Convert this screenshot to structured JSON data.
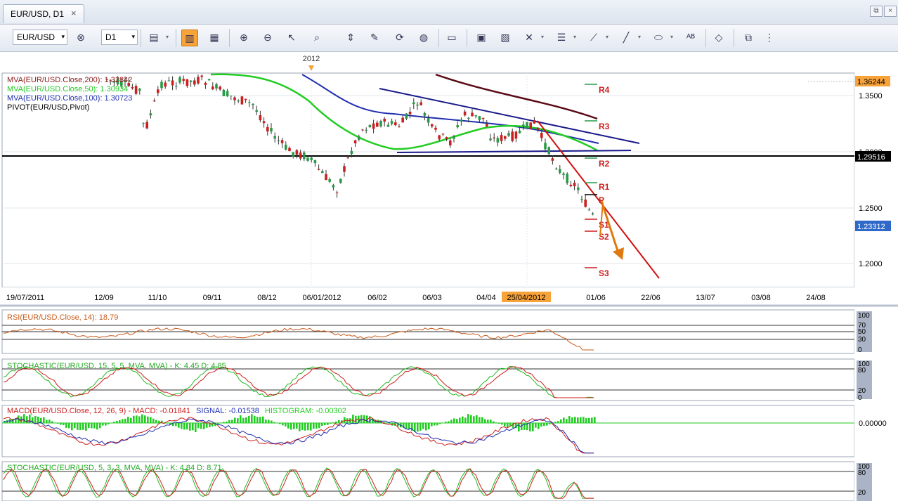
{
  "tab": {
    "label": "EUR/USD, D1",
    "close": "×"
  },
  "window_controls": {
    "restore": "⧉",
    "close": "×"
  },
  "toolbar": {
    "symbol": "EUR/USD",
    "timeframe": "D1",
    "dropdown_arrow": "▾"
  },
  "main_chart": {
    "year_label": "2012",
    "indicators": [
      {
        "text": "MVA(EUR/USD.Close,200): 1.32842",
        "color": "#8b1a1a"
      },
      {
        "text": "MVA(EUR/USD.Close,50): 1.30934",
        "color": "#22cc22"
      },
      {
        "text": "MVA(EUR/USD.Close,100): 1.30723",
        "color": "#1f2fb0"
      },
      {
        "text": "PIVOT(EUR/USD,Pivot)",
        "color": "#000000"
      }
    ],
    "price_labels": [
      "1.3500",
      "1.3000",
      "1.2500",
      "1.2000"
    ],
    "price_badges": {
      "top": "1.36244",
      "level": "1.29516",
      "last": "1.23312"
    },
    "pivots": [
      "R4",
      "R3",
      "R2",
      "R1",
      "P",
      "S1",
      "S2",
      "S3"
    ],
    "x_labels": [
      "19/07/2011",
      "12/09",
      "11/10",
      "09/11",
      "08/12",
      "06/01/2012",
      "06/02",
      "06/03",
      "04/04",
      "25/04/2012",
      "01/06",
      "22/06",
      "13/07",
      "03/08",
      "24/08"
    ]
  },
  "rsi": {
    "title": "RSI(EUR/USD.Close, 14): 18.79",
    "scale": [
      "100",
      "70",
      "50",
      "30",
      "0"
    ]
  },
  "stoch1": {
    "title": "STOCHASTIC(EUR/USD, 15, 5, 5, MVA, MVA) - K: 4.45  D: 4.85",
    "scale": [
      "100",
      "80",
      "20",
      "0"
    ]
  },
  "macd": {
    "title_main": "MACD(EUR/USD.Close, 12, 26, 9) - MACD: -0.01841",
    "title_signal": "SIGNAL: -0.01538",
    "title_hist": "HISTOGRAM: -0.00302",
    "scale": "0.00000"
  },
  "stoch2": {
    "title": "STOCHASTIC(EUR/USD, 5, 3, 3, MVA, MVA) - K: 4.84  D: 8.71",
    "scale": [
      "100",
      "80",
      "20"
    ]
  },
  "colors": {
    "orange": "#f8a23a",
    "badge_blue": "#2e68c8",
    "bull": "#2a9a4a",
    "bear": "#cc1f1f"
  }
}
